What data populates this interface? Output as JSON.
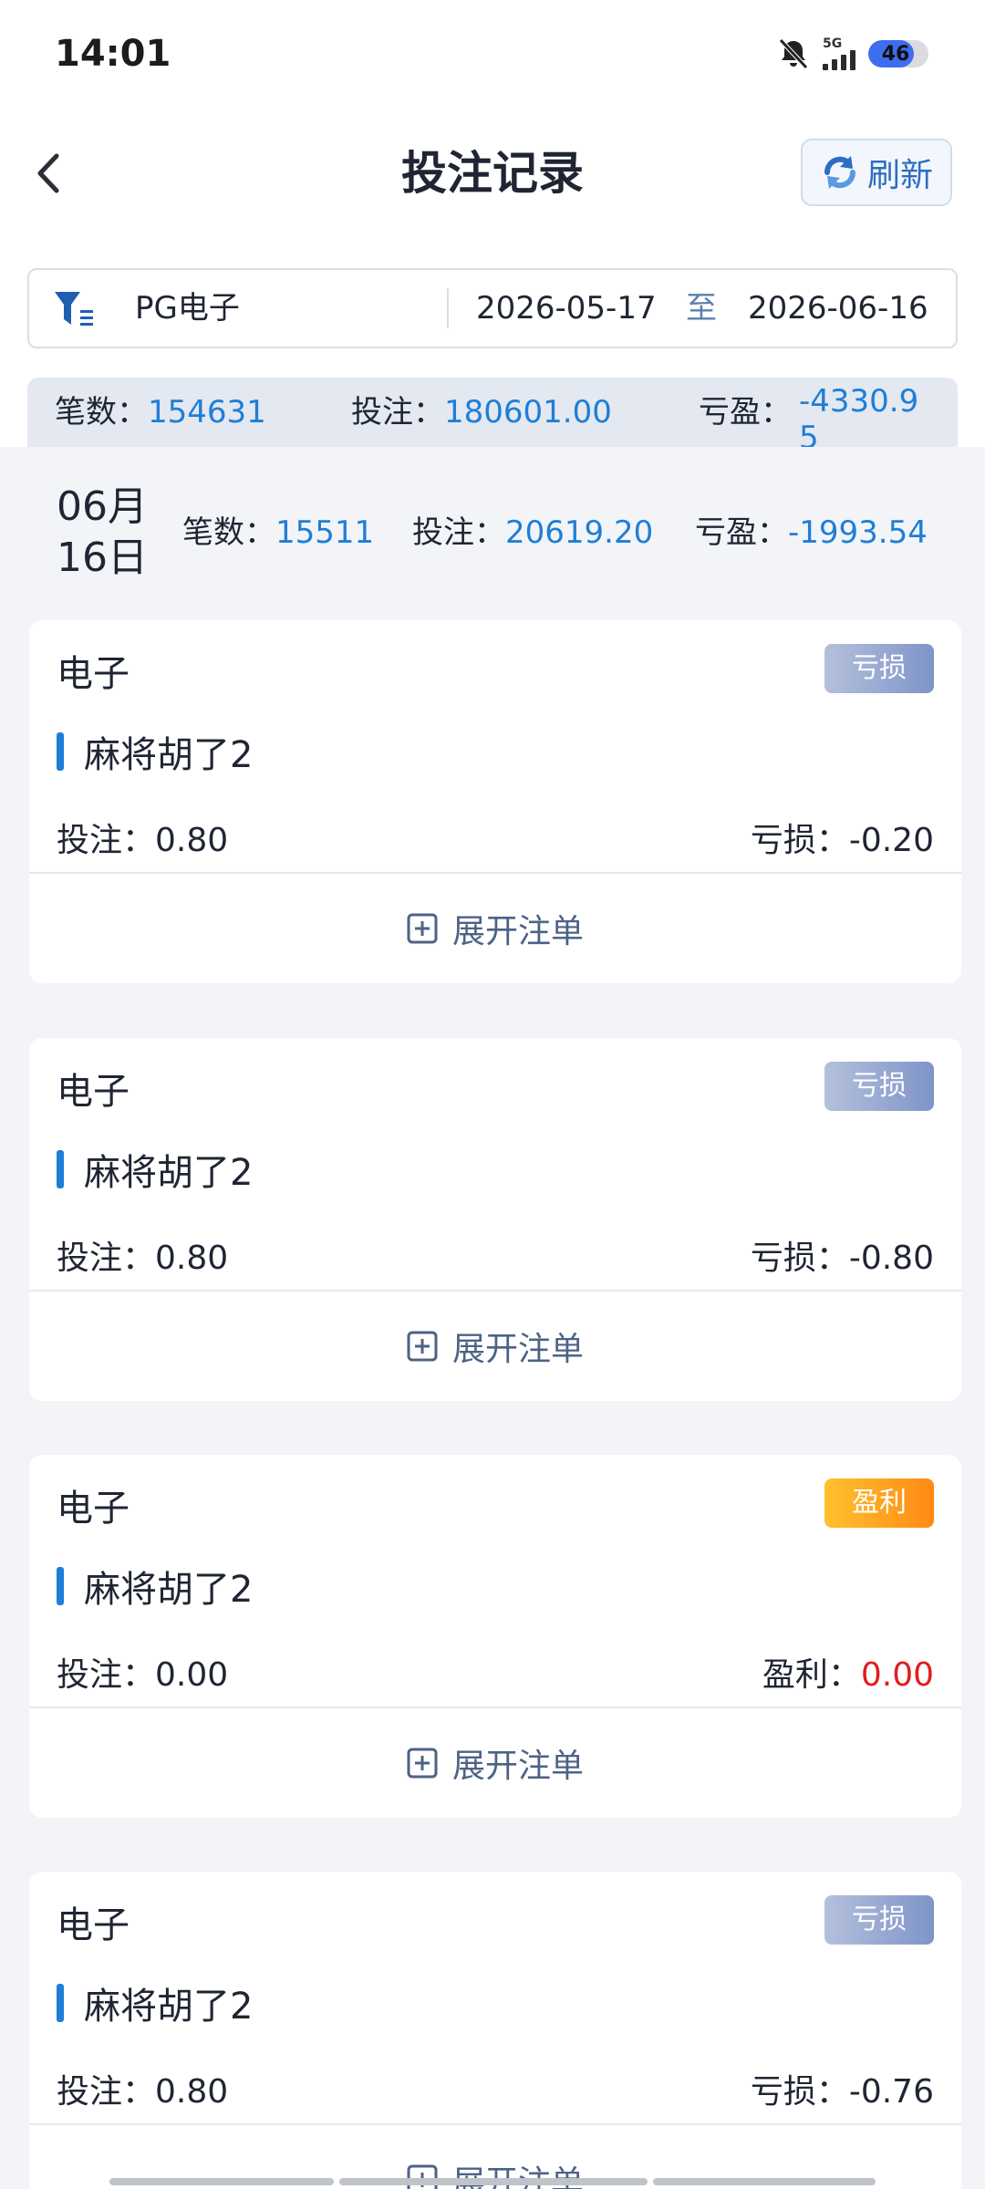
{
  "status_bar": {
    "time": "14:01",
    "network": "5G",
    "battery": "46",
    "battery_level": 0.46
  },
  "header": {
    "back_icon": "chevron-left-icon",
    "title": "投注记录",
    "refresh_label": "刷新",
    "refresh_icon": "refresh-icon"
  },
  "filter": {
    "game": "PG电子",
    "date_start": "2026-05-17",
    "date_separator": "至",
    "date_end": "2026-06-16"
  },
  "summary": {
    "count_label": "笔数：",
    "count_value": "154631",
    "bet_label": "投注：",
    "bet_value": "180601.00",
    "pl_label": "亏盈：",
    "pl_value": "-4330.95"
  },
  "day": {
    "month": "06月",
    "day": "16日",
    "count_label": "笔数：",
    "count_value": "15511",
    "bet_label": "投注：",
    "bet_value": "20619.20",
    "pl_label": "亏盈：",
    "pl_value": "-1993.54"
  },
  "records": [
    {
      "category": "电子",
      "badge": "亏损",
      "game": "麻将胡了2",
      "bet_label": "投注：",
      "bet_value": "0.80",
      "result_label": "亏损：",
      "result_value": "-0.20",
      "expand_label": "展开注单"
    },
    {
      "category": "电子",
      "badge": "亏损",
      "game": "麻将胡了2",
      "bet_label": "投注：",
      "bet_value": "0.80",
      "result_label": "亏损：",
      "result_value": "-0.80",
      "expand_label": "展开注单"
    },
    {
      "category": "电子",
      "badge": "盈利",
      "game": "麻将胡了2",
      "bet_label": "投注：",
      "bet_value": "0.00",
      "result_label": "盈利：",
      "result_value": "0.00",
      "expand_label": "展开注单"
    },
    {
      "category": "电子",
      "badge": "亏损",
      "game": "麻将胡了2",
      "bet_label": "投注：",
      "bet_value": "0.80",
      "result_label": "亏损：",
      "result_value": "-0.76",
      "expand_label": "展开注单"
    }
  ],
  "colors": {
    "accent_blue": "#1f7ed6",
    "loss_badge": "#8a9dcc",
    "win_badge": "#ff9a1a",
    "profit_red": "#e01e1e"
  }
}
